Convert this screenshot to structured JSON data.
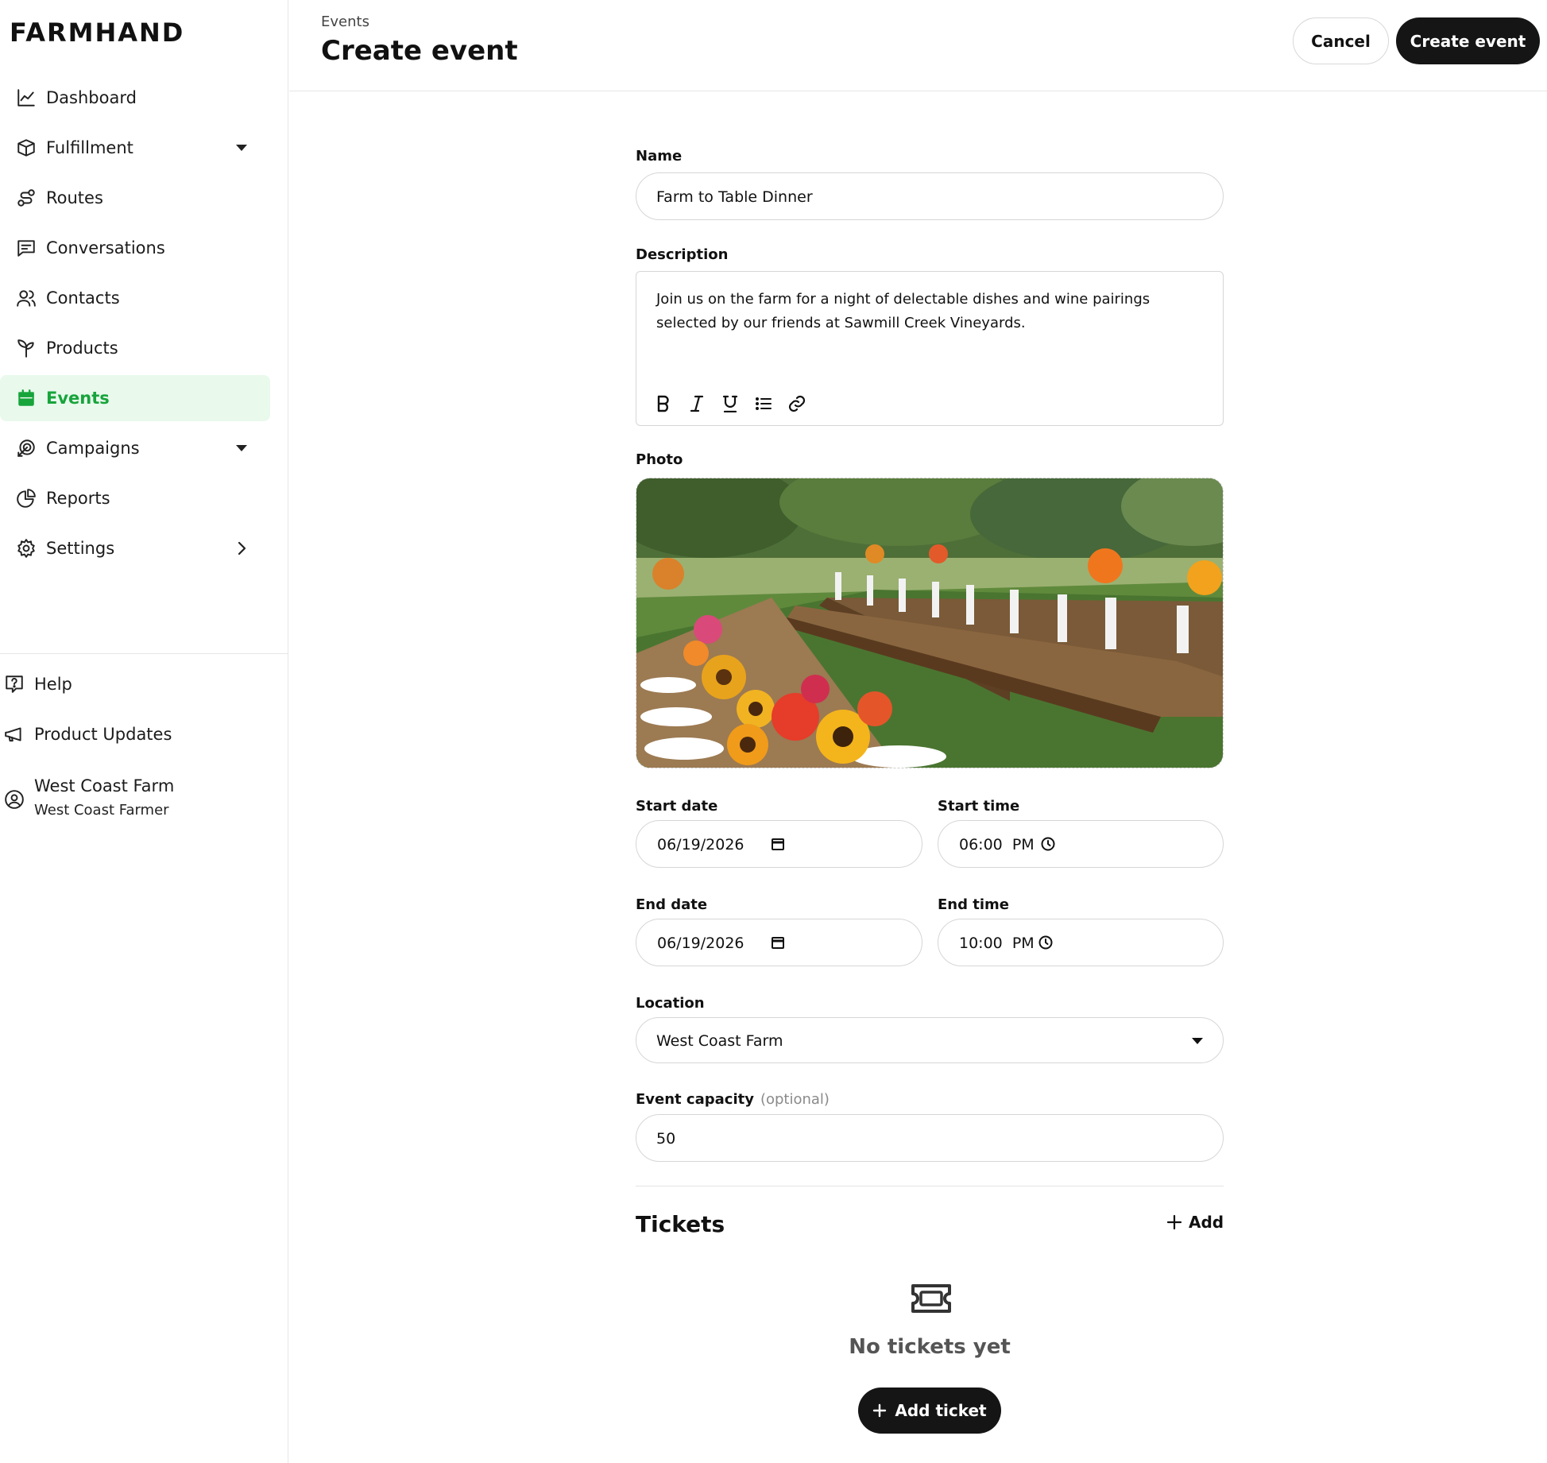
{
  "app": {
    "logo": "FARMHAND"
  },
  "sidebar": {
    "items": [
      {
        "label": "Dashboard",
        "icon": "chart-line-icon"
      },
      {
        "label": "Fulfillment",
        "icon": "box-icon",
        "expand": "chevron-down-icon"
      },
      {
        "label": "Routes",
        "icon": "route-icon"
      },
      {
        "label": "Conversations",
        "icon": "message-icon"
      },
      {
        "label": "Contacts",
        "icon": "users-icon"
      },
      {
        "label": "Products",
        "icon": "sprout-icon"
      },
      {
        "label": "Events",
        "icon": "calendar-icon",
        "active": true
      },
      {
        "label": "Campaigns",
        "icon": "megaphone-target-icon",
        "expand": "chevron-down-icon"
      },
      {
        "label": "Reports",
        "icon": "pie-chart-icon"
      },
      {
        "label": "Settings",
        "icon": "gear-icon",
        "expand": "chevron-right-icon"
      }
    ],
    "footer": {
      "help": "Help",
      "updates": "Product Updates",
      "account_name": "West Coast Farm",
      "account_user": "West Coast Farmer"
    }
  },
  "header": {
    "breadcrumb": "Events",
    "title": "Create event",
    "cancel_label": "Cancel",
    "create_label": "Create event"
  },
  "form": {
    "name_label": "Name",
    "name_value": "Farm to Table Dinner",
    "description_label": "Description",
    "description_value": "Join us on the farm for a night of delectable dishes and wine pairings selected by our friends at Sawmill Creek Vineyards.",
    "photo_label": "Photo",
    "start_date_label": "Start date",
    "start_date_value": "06/19/2026",
    "start_time_label": "Start time",
    "start_time_value": "06:00  PM",
    "end_date_label": "End date",
    "end_date_value": "06/19/2026",
    "end_time_label": "End time",
    "end_time_value": "10:00  PM",
    "location_label": "Location",
    "location_value": "West Coast Farm",
    "capacity_label": "Event capacity",
    "capacity_optional": "(optional)",
    "capacity_value": "50"
  },
  "tickets": {
    "title": "Tickets",
    "add_label": "Add",
    "empty_text": "No tickets yet",
    "add_ticket_label": "Add ticket"
  },
  "colors": {
    "accent_green": "#17a43b",
    "active_bg": "#e9f9ec",
    "primary_button": "#151515"
  }
}
